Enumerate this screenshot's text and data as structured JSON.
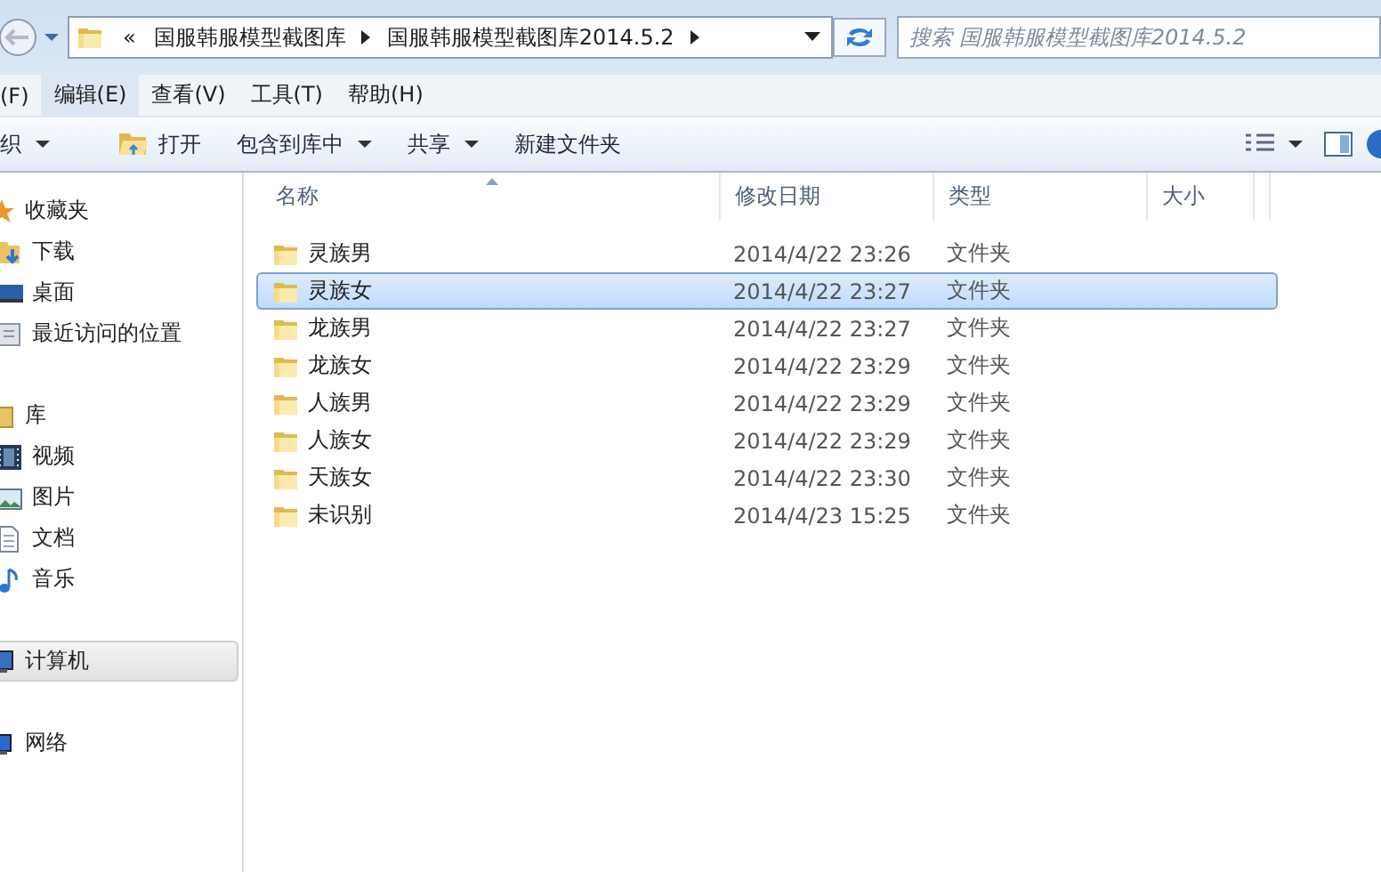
{
  "address_bar": {
    "breadcrumbs": [
      {
        "label": "«",
        "kind": "overflow"
      },
      {
        "label": "国服韩服模型截图库",
        "kind": "crumb"
      },
      {
        "label": "国服韩服模型截图库2014.5.2",
        "kind": "crumb"
      }
    ]
  },
  "search": {
    "placeholder": "搜索 国服韩服模型截图库2014.5.2"
  },
  "menu": [
    {
      "label": "(F)",
      "selected": false
    },
    {
      "label": "编辑(E)",
      "selected": true
    },
    {
      "label": "查看(V)",
      "selected": false
    },
    {
      "label": "工具(T)",
      "selected": false
    },
    {
      "label": "帮助(H)",
      "selected": false
    }
  ],
  "toolbar": [
    {
      "label": "织",
      "kind": "dropdown"
    },
    {
      "label": "打开",
      "kind": "open"
    },
    {
      "label": "包含到库中",
      "kind": "dropdown"
    },
    {
      "label": "共享",
      "kind": "dropdown"
    },
    {
      "label": "新建文件夹",
      "kind": "plain"
    }
  ],
  "sidebar": [
    {
      "label": "收藏夹",
      "selected": false,
      "children": [
        {
          "label": "下载",
          "selected": false
        },
        {
          "label": "桌面",
          "selected": false
        },
        {
          "label": "最近访问的位置",
          "selected": false
        }
      ]
    },
    {
      "label": "库",
      "selected": false,
      "children": [
        {
          "label": "视频",
          "selected": false
        },
        {
          "label": "图片",
          "selected": false
        },
        {
          "label": "文档",
          "selected": false
        },
        {
          "label": "音乐",
          "selected": false
        }
      ]
    },
    {
      "label": "计算机",
      "selected": true
    },
    {
      "label": "网络",
      "selected": false
    }
  ],
  "table": {
    "columns": [
      "名称",
      "修改日期",
      "类型",
      "大小"
    ],
    "rows": [
      {
        "name": "灵族男",
        "modified": "2014/4/22 23:26",
        "type": "文件夹",
        "selected": false
      },
      {
        "name": "灵族女",
        "modified": "2014/4/22 23:27",
        "type": "文件夹",
        "selected": true
      },
      {
        "name": "龙族男",
        "modified": "2014/4/22 23:27",
        "type": "文件夹",
        "selected": false
      },
      {
        "name": "龙族女",
        "modified": "2014/4/22 23:29",
        "type": "文件夹",
        "selected": false
      },
      {
        "name": "人族男",
        "modified": "2014/4/22 23:29",
        "type": "文件夹",
        "selected": false
      },
      {
        "name": "人族女",
        "modified": "2014/4/22 23:29",
        "type": "文件夹",
        "selected": false
      },
      {
        "name": "天族女",
        "modified": "2014/4/22 23:30",
        "type": "文件夹",
        "selected": false
      },
      {
        "name": "未识别",
        "modified": "2014/4/23 15:25",
        "type": "文件夹",
        "selected": false
      }
    ]
  }
}
